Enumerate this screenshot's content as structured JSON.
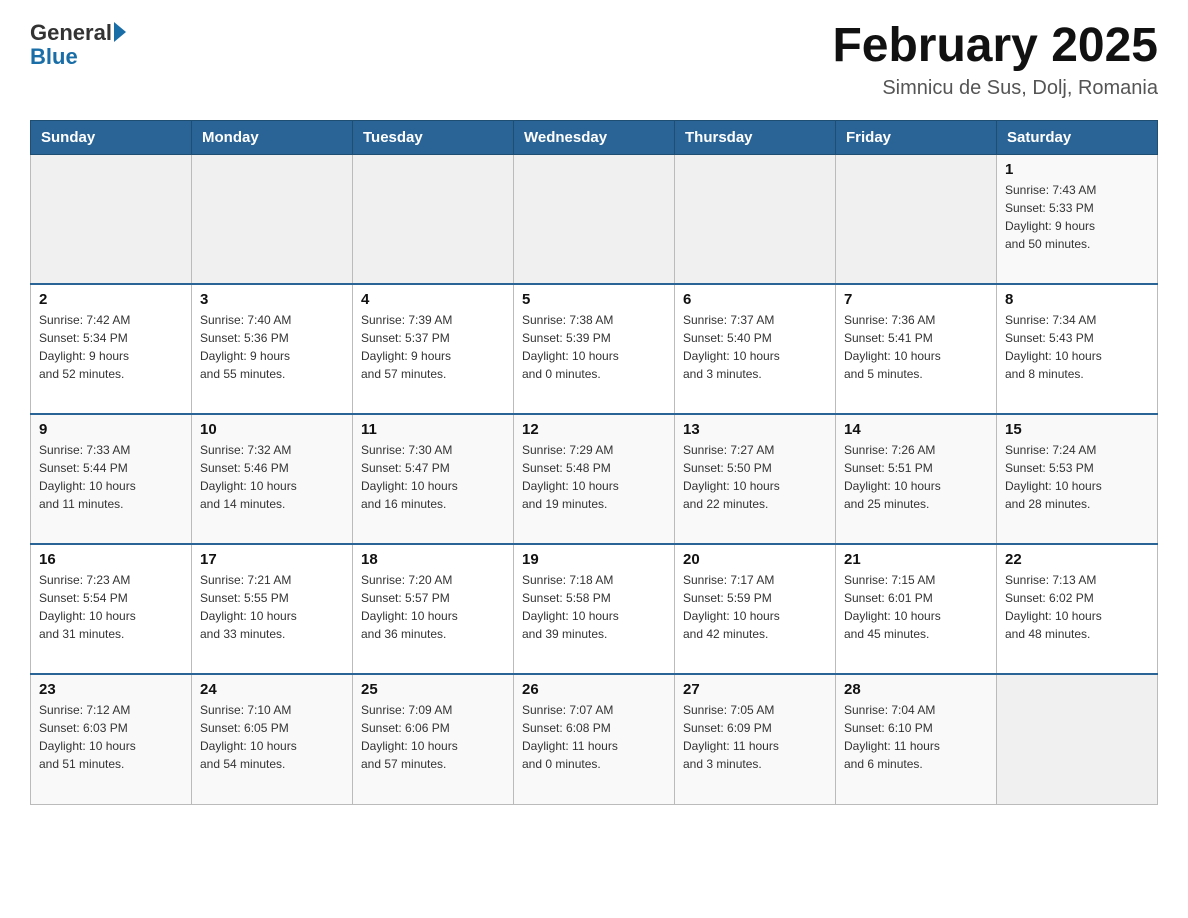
{
  "header": {
    "logo": {
      "general": "General",
      "blue": "Blue",
      "arrow": "▶"
    },
    "title": "February 2025",
    "subtitle": "Simnicu de Sus, Dolj, Romania"
  },
  "days_of_week": [
    "Sunday",
    "Monday",
    "Tuesday",
    "Wednesday",
    "Thursday",
    "Friday",
    "Saturday"
  ],
  "weeks": [
    [
      {
        "day": "",
        "info": ""
      },
      {
        "day": "",
        "info": ""
      },
      {
        "day": "",
        "info": ""
      },
      {
        "day": "",
        "info": ""
      },
      {
        "day": "",
        "info": ""
      },
      {
        "day": "",
        "info": ""
      },
      {
        "day": "1",
        "info": "Sunrise: 7:43 AM\nSunset: 5:33 PM\nDaylight: 9 hours\nand 50 minutes."
      }
    ],
    [
      {
        "day": "2",
        "info": "Sunrise: 7:42 AM\nSunset: 5:34 PM\nDaylight: 9 hours\nand 52 minutes."
      },
      {
        "day": "3",
        "info": "Sunrise: 7:40 AM\nSunset: 5:36 PM\nDaylight: 9 hours\nand 55 minutes."
      },
      {
        "day": "4",
        "info": "Sunrise: 7:39 AM\nSunset: 5:37 PM\nDaylight: 9 hours\nand 57 minutes."
      },
      {
        "day": "5",
        "info": "Sunrise: 7:38 AM\nSunset: 5:39 PM\nDaylight: 10 hours\nand 0 minutes."
      },
      {
        "day": "6",
        "info": "Sunrise: 7:37 AM\nSunset: 5:40 PM\nDaylight: 10 hours\nand 3 minutes."
      },
      {
        "day": "7",
        "info": "Sunrise: 7:36 AM\nSunset: 5:41 PM\nDaylight: 10 hours\nand 5 minutes."
      },
      {
        "day": "8",
        "info": "Sunrise: 7:34 AM\nSunset: 5:43 PM\nDaylight: 10 hours\nand 8 minutes."
      }
    ],
    [
      {
        "day": "9",
        "info": "Sunrise: 7:33 AM\nSunset: 5:44 PM\nDaylight: 10 hours\nand 11 minutes."
      },
      {
        "day": "10",
        "info": "Sunrise: 7:32 AM\nSunset: 5:46 PM\nDaylight: 10 hours\nand 14 minutes."
      },
      {
        "day": "11",
        "info": "Sunrise: 7:30 AM\nSunset: 5:47 PM\nDaylight: 10 hours\nand 16 minutes."
      },
      {
        "day": "12",
        "info": "Sunrise: 7:29 AM\nSunset: 5:48 PM\nDaylight: 10 hours\nand 19 minutes."
      },
      {
        "day": "13",
        "info": "Sunrise: 7:27 AM\nSunset: 5:50 PM\nDaylight: 10 hours\nand 22 minutes."
      },
      {
        "day": "14",
        "info": "Sunrise: 7:26 AM\nSunset: 5:51 PM\nDaylight: 10 hours\nand 25 minutes."
      },
      {
        "day": "15",
        "info": "Sunrise: 7:24 AM\nSunset: 5:53 PM\nDaylight: 10 hours\nand 28 minutes."
      }
    ],
    [
      {
        "day": "16",
        "info": "Sunrise: 7:23 AM\nSunset: 5:54 PM\nDaylight: 10 hours\nand 31 minutes."
      },
      {
        "day": "17",
        "info": "Sunrise: 7:21 AM\nSunset: 5:55 PM\nDaylight: 10 hours\nand 33 minutes."
      },
      {
        "day": "18",
        "info": "Sunrise: 7:20 AM\nSunset: 5:57 PM\nDaylight: 10 hours\nand 36 minutes."
      },
      {
        "day": "19",
        "info": "Sunrise: 7:18 AM\nSunset: 5:58 PM\nDaylight: 10 hours\nand 39 minutes."
      },
      {
        "day": "20",
        "info": "Sunrise: 7:17 AM\nSunset: 5:59 PM\nDaylight: 10 hours\nand 42 minutes."
      },
      {
        "day": "21",
        "info": "Sunrise: 7:15 AM\nSunset: 6:01 PM\nDaylight: 10 hours\nand 45 minutes."
      },
      {
        "day": "22",
        "info": "Sunrise: 7:13 AM\nSunset: 6:02 PM\nDaylight: 10 hours\nand 48 minutes."
      }
    ],
    [
      {
        "day": "23",
        "info": "Sunrise: 7:12 AM\nSunset: 6:03 PM\nDaylight: 10 hours\nand 51 minutes."
      },
      {
        "day": "24",
        "info": "Sunrise: 7:10 AM\nSunset: 6:05 PM\nDaylight: 10 hours\nand 54 minutes."
      },
      {
        "day": "25",
        "info": "Sunrise: 7:09 AM\nSunset: 6:06 PM\nDaylight: 10 hours\nand 57 minutes."
      },
      {
        "day": "26",
        "info": "Sunrise: 7:07 AM\nSunset: 6:08 PM\nDaylight: 11 hours\nand 0 minutes."
      },
      {
        "day": "27",
        "info": "Sunrise: 7:05 AM\nSunset: 6:09 PM\nDaylight: 11 hours\nand 3 minutes."
      },
      {
        "day": "28",
        "info": "Sunrise: 7:04 AM\nSunset: 6:10 PM\nDaylight: 11 hours\nand 6 minutes."
      },
      {
        "day": "",
        "info": ""
      }
    ]
  ]
}
